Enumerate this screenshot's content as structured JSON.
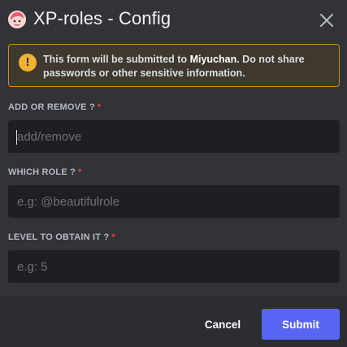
{
  "header": {
    "title": "XP-roles - Config",
    "avatar_icon": "app-avatar-icon",
    "close_icon": "close-icon"
  },
  "notice": {
    "icon": "warning-icon",
    "icon_glyph": "!",
    "text_before": "This form will be submitted to ",
    "app_name": "Miyuchan",
    "text_after": ". Do not share passwords or other sensitive information."
  },
  "fields": [
    {
      "label": "ADD OR REMOVE ?",
      "required_mark": "*",
      "value": "",
      "placeholder": "add/remove"
    },
    {
      "label": "WHICH ROLE ?",
      "required_mark": "*",
      "value": "",
      "placeholder": "e.g: @beautifulrole"
    },
    {
      "label": "LEVEL TO OBTAIN IT ?",
      "required_mark": "*",
      "value": "",
      "placeholder": "e.g: 5"
    }
  ],
  "footer": {
    "cancel_label": "Cancel",
    "submit_label": "Submit"
  },
  "colors": {
    "background": "#313338",
    "footer": "#2b2d31",
    "input": "#1e1f22",
    "accent": "#5865f2",
    "warning": "#f0b232",
    "required": "#f23f43"
  }
}
